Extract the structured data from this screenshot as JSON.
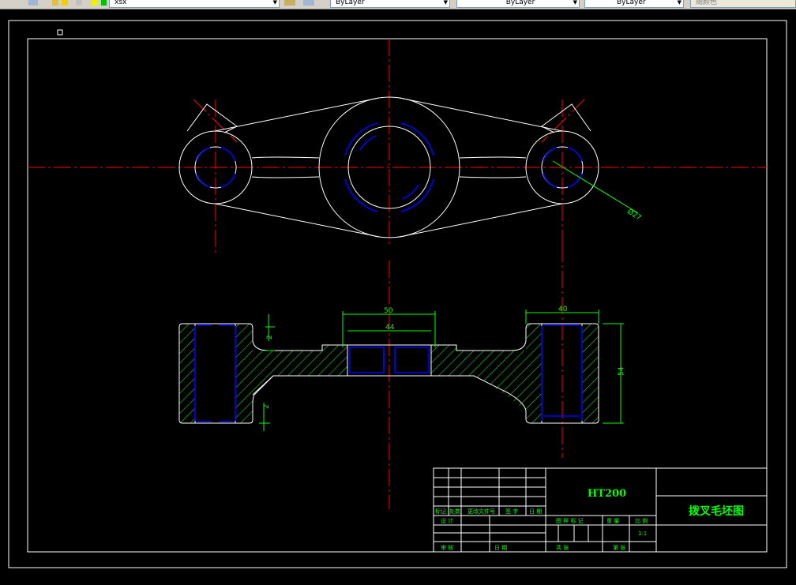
{
  "toolbar": {
    "layer_value": "xsx",
    "color_value": "ByLayer",
    "linetype_value": "ByLayer",
    "lineweight_value": "ByLayer",
    "plotstyle_value": "随颜色"
  },
  "dimensions": {
    "d_radius": "Ø27",
    "d_50": "50",
    "d_44": "44",
    "d_40": "40",
    "d_54": "54",
    "d_2a": "2",
    "d_2b": "2"
  },
  "title_block": {
    "material": "HT200",
    "drawing_title": "拨叉毛坯图",
    "scale_value": "1:1",
    "hdr_mark": "标记",
    "hdr_count": "处数",
    "hdr_doc": "更改文件号",
    "hdr_sign": "签 字",
    "hdr_date": "日 期",
    "hdr_design": "设 计",
    "hdr_review": "审 核",
    "hdr_date2": "日 期",
    "hdr_stage": "图 样 标 记",
    "hdr_weight": "重 量",
    "hdr_scale": "比 例",
    "hdr_total": "共    张",
    "hdr_sheet": "第    张"
  },
  "colors": {
    "background": "#000000",
    "center_line": "#ff0000",
    "outline": "#ffffff",
    "hidden": "#0000ff",
    "dimension": "#00ff00",
    "hatch": "#00ff00"
  }
}
